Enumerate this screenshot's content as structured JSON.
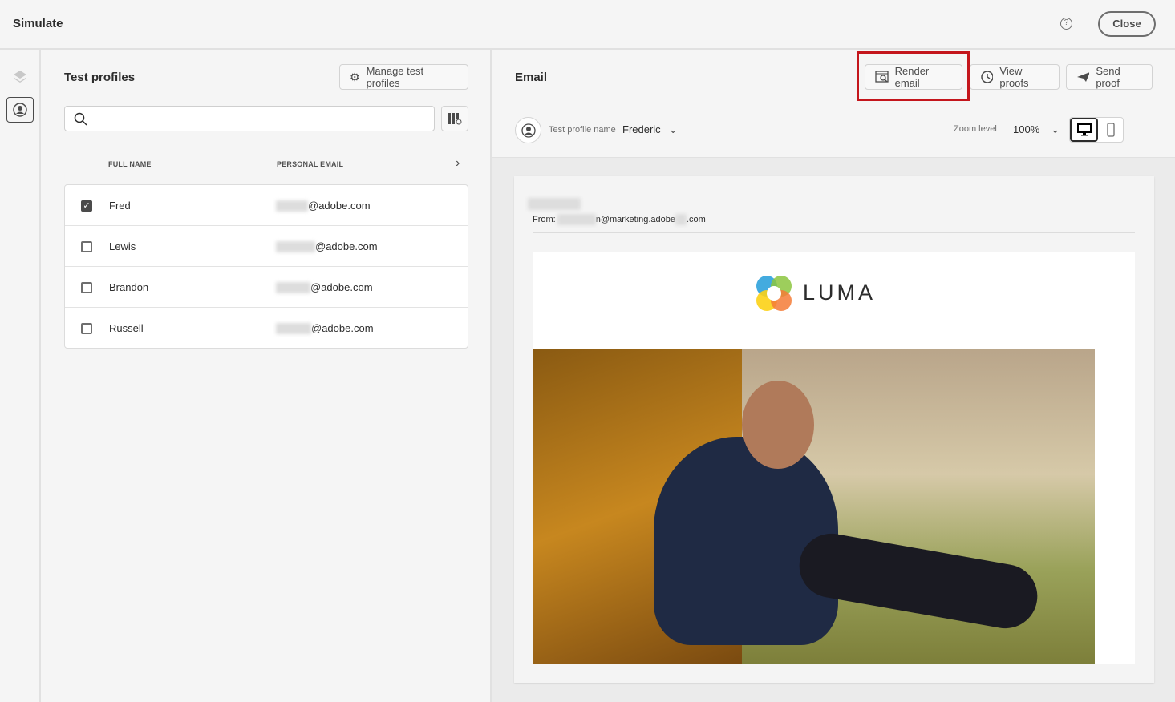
{
  "header": {
    "title": "Simulate",
    "help_icon": "?",
    "close_label": "Close"
  },
  "test_profiles": {
    "title": "Test profiles",
    "manage_label": "Manage test profiles",
    "search_placeholder": "",
    "columns": [
      "FULL NAME",
      "PERSONAL EMAIL"
    ],
    "rows": [
      {
        "name": "Fred",
        "email": "@adobe.com",
        "checked": true
      },
      {
        "name": "Lewis",
        "email": "@adobe.com",
        "checked": false
      },
      {
        "name": "Brandon",
        "email": "@adobe.com",
        "checked": false
      },
      {
        "name": "Russell",
        "email": "@adobe.com",
        "checked": false
      }
    ]
  },
  "email": {
    "title": "Email",
    "render_label": "Render email",
    "view_proofs_label": "View proofs",
    "send_proof_label": "Send proof",
    "profile_label": "Test profile name",
    "profile_value": "Frederic",
    "zoom_label": "Zoom level",
    "zoom_value": "100%",
    "from_label": "From:",
    "from_value_a": "n@marketing.adobe",
    "from_value_b": ".com",
    "brand": "LUMA"
  },
  "colors": {
    "highlight": "#c4161c"
  }
}
